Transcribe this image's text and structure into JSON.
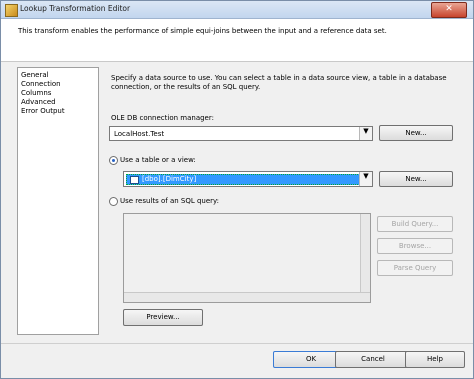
{
  "window": {
    "title": "Lookup Transformation Editor",
    "close_glyph": "✕"
  },
  "header": {
    "description": "This transform enables the performance of simple equi-joins between the input and a reference data set."
  },
  "nav": {
    "items": [
      {
        "label": "General"
      },
      {
        "label": "Connection"
      },
      {
        "label": "Columns"
      },
      {
        "label": "Advanced"
      },
      {
        "label": "Error Output"
      }
    ]
  },
  "connection": {
    "instructions": "Specify a data source to use. You can select a table in a data source view, a table in a database connection, or the results of an SQL query.",
    "manager_label": "OLE DB connection manager:",
    "manager_value": "LocalHost.Test",
    "manager_new_label": "New...",
    "use_table_label": "Use a table or a view:",
    "table_value": "[dbo].[DimCity]",
    "table_new_label": "New...",
    "use_sql_label": "Use results of an SQL query:",
    "build_query_label": "Build Query...",
    "browse_label": "Browse...",
    "parse_query_label": "Parse Query",
    "preview_label": "Preview..."
  },
  "footer": {
    "ok_label": "OK",
    "cancel_label": "Cancel",
    "help_label": "Help"
  }
}
